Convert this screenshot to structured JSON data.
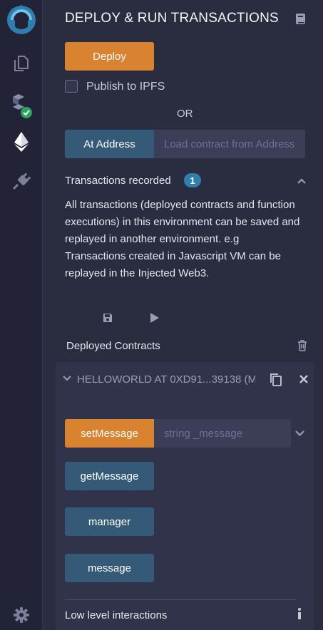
{
  "header": {
    "title": "DEPLOY & RUN TRANSACTIONS"
  },
  "deploy": {
    "button_label": "Deploy",
    "publish_label": "Publish to IPFS",
    "or_label": "OR"
  },
  "at_address": {
    "button_label": "At Address",
    "placeholder": "Load contract from Address"
  },
  "transactions": {
    "label": "Transactions recorded",
    "count": "1",
    "description": "All transactions (deployed contracts and function executions) in this environment can be saved and replayed in another environment. e.g Transactions created in Javascript VM can be replayed in the Injected Web3."
  },
  "deployed": {
    "label": "Deployed Contracts",
    "instance_title": "HELLOWORLD AT 0XD91...39138 (M",
    "functions": {
      "set_message": {
        "label": "setMessage",
        "placeholder": "string _message"
      },
      "get_message": "getMessage",
      "manager": "manager",
      "message": "message"
    },
    "low_level_label": "Low level interactions"
  },
  "colors": {
    "accent_orange": "#d9822f",
    "call_blue": "#355a78",
    "badge_blue": "#2f7fae",
    "check_green": "#28a55b"
  },
  "icons": [
    "remix-logo-icon",
    "file-explorer-icon",
    "compiler-icon",
    "deploy-run-icon",
    "plugin-manager-icon",
    "settings-icon",
    "book-icon",
    "save-icon",
    "play-icon",
    "chevron-up-icon",
    "trash-icon",
    "chevron-down-icon",
    "copy-icon",
    "close-icon",
    "info-icon"
  ]
}
